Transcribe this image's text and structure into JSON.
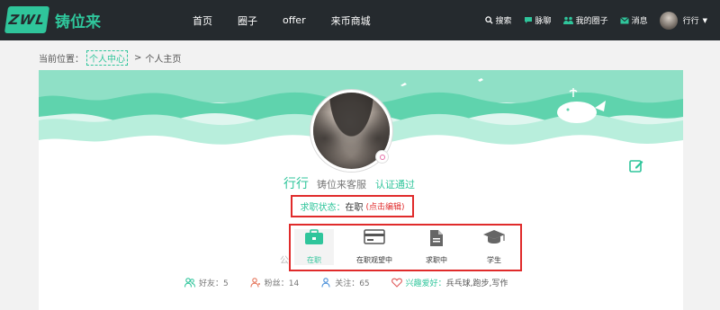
{
  "brand": {
    "logo_mark": "ZWL",
    "logo_text": "铸位来"
  },
  "nav": {
    "items": [
      "首页",
      "圈子",
      "offer",
      "来币商城"
    ]
  },
  "right_nav": {
    "search": "搜索",
    "chat": "脉聊",
    "circles": "我的圈子",
    "messages": "消息",
    "user": "行行"
  },
  "breadcrumb": {
    "prefix": "当前位置：",
    "link": "个人中心",
    "sep": ">",
    "current": "个人主页"
  },
  "profile": {
    "name": "行行",
    "role": "铸位来客服",
    "verified": "认证通过"
  },
  "job_status": {
    "label": "求职状态：",
    "value": "在职",
    "edit": "(点击编辑)"
  },
  "job_options": [
    {
      "label": "在职",
      "icon": "briefcase-icon",
      "active": true
    },
    {
      "label": "在职观望中",
      "icon": "card-icon",
      "active": false
    },
    {
      "label": "求职中",
      "icon": "document-icon",
      "active": false
    },
    {
      "label": "学生",
      "icon": "graduation-cap-icon",
      "active": false
    }
  ],
  "stats": {
    "friends": "好友：5",
    "fans": "粉丝：14",
    "follows": "关注：65",
    "hobby_label": "兴趣爱好：",
    "hobby_value": "兵乓球,跑步,写作"
  },
  "ghost_char": "公",
  "colors": {
    "accent": "#2fc59b",
    "topbar": "#252a2e",
    "highlight_border": "#e02b2b"
  }
}
